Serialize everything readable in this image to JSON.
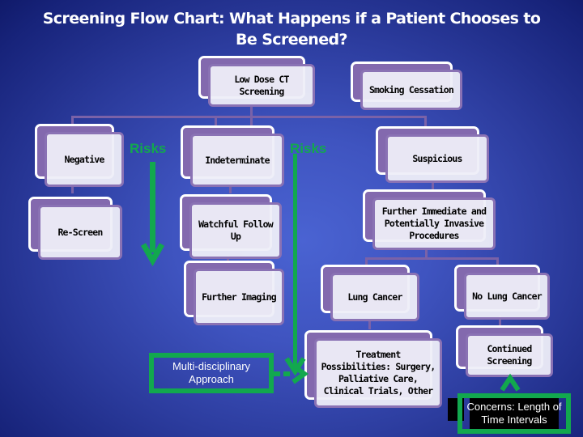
{
  "title": "Screening Flow Chart: What Happens if a Patient Chooses to Be Screened?",
  "nodes": {
    "low_dose_ct": "Low Dose CT Screening",
    "smoking_cessation": "Smoking Cessation",
    "negative": "Negative",
    "re_screen": "Re-Screen",
    "indeterminate": "Indeterminate",
    "watchful_follow_up": "Watchful Follow Up",
    "further_imaging": "Further Imaging",
    "suspicious": "Suspicious",
    "further_procedures": "Further Immediate and Potentially Invasive Procedures",
    "lung_cancer": "Lung Cancer",
    "no_lung_cancer": "No Lung Cancer",
    "treatment": "Treatment Possibilities: Surgery, Palliative Care, Clinical Trials, Other",
    "continued_screening": "Continued Screening"
  },
  "annotations": {
    "risks_left": "Risks",
    "risks_middle": "Risks",
    "multidisciplinary": "Multi-disciplinary Approach",
    "concerns": "Concerns: Length of Time Intervals"
  },
  "colors": {
    "accent_green": "#12a84e",
    "node_purple": "#8369ae",
    "node_fill": "#eeeef8",
    "background": "#3f54c0"
  }
}
